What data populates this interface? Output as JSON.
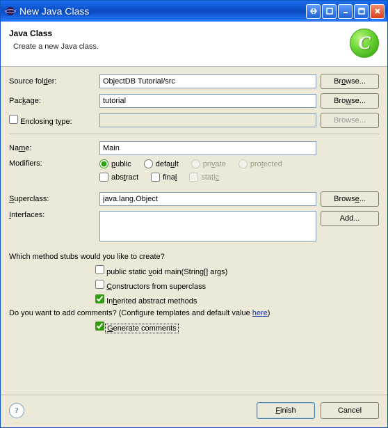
{
  "window": {
    "title": "New Java Class"
  },
  "banner": {
    "title": "Java Class",
    "subtitle": "Create a new Java class."
  },
  "labels": {
    "source_folder": "Source folder:",
    "package": "Package:",
    "enclosing_type": "Enclosing type:",
    "name": "Name:",
    "modifiers": "Modifiers:",
    "superclass": "Superclass:",
    "interfaces": "Interfaces:"
  },
  "fields": {
    "source_folder": "ObjectDB Tutorial/src",
    "package": "tutorial",
    "enclosing_type": "",
    "name": "Main",
    "superclass": "java.lang.Object"
  },
  "buttons": {
    "browse": "Browse...",
    "add": "Add...",
    "finish": "Finish",
    "cancel": "Cancel"
  },
  "modifiers": {
    "public": "public",
    "default": "default",
    "private": "private",
    "protected": "protected",
    "abstract": "abstract",
    "final": "final",
    "static": "static"
  },
  "stubs": {
    "question": "Which method stubs would you like to create?",
    "main": "public static void main(String[] args)",
    "constructors": "Constructors from superclass",
    "inherited": "Inherited abstract methods"
  },
  "comments": {
    "question_prefix": "Do you want to add comments? (Configure templates and default value ",
    "here": "here",
    "question_suffix": ")",
    "generate": "Generate comments"
  }
}
